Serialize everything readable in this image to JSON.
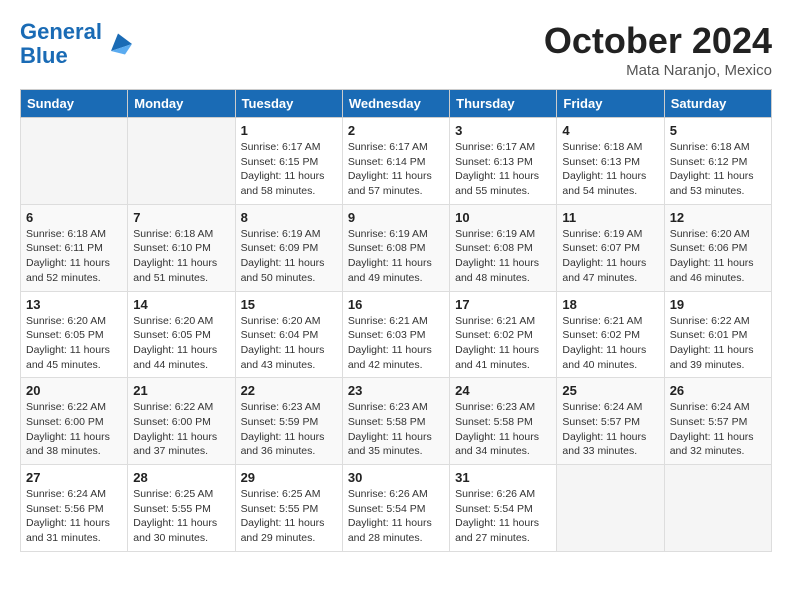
{
  "header": {
    "logo_line1": "General",
    "logo_line2": "Blue",
    "month": "October 2024",
    "location": "Mata Naranjo, Mexico"
  },
  "days_of_week": [
    "Sunday",
    "Monday",
    "Tuesday",
    "Wednesday",
    "Thursday",
    "Friday",
    "Saturday"
  ],
  "weeks": [
    [
      {
        "day": "",
        "sunrise": "",
        "sunset": "",
        "daylight": ""
      },
      {
        "day": "",
        "sunrise": "",
        "sunset": "",
        "daylight": ""
      },
      {
        "day": "1",
        "sunrise": "Sunrise: 6:17 AM",
        "sunset": "Sunset: 6:15 PM",
        "daylight": "Daylight: 11 hours and 58 minutes."
      },
      {
        "day": "2",
        "sunrise": "Sunrise: 6:17 AM",
        "sunset": "Sunset: 6:14 PM",
        "daylight": "Daylight: 11 hours and 57 minutes."
      },
      {
        "day": "3",
        "sunrise": "Sunrise: 6:17 AM",
        "sunset": "Sunset: 6:13 PM",
        "daylight": "Daylight: 11 hours and 55 minutes."
      },
      {
        "day": "4",
        "sunrise": "Sunrise: 6:18 AM",
        "sunset": "Sunset: 6:13 PM",
        "daylight": "Daylight: 11 hours and 54 minutes."
      },
      {
        "day": "5",
        "sunrise": "Sunrise: 6:18 AM",
        "sunset": "Sunset: 6:12 PM",
        "daylight": "Daylight: 11 hours and 53 minutes."
      }
    ],
    [
      {
        "day": "6",
        "sunrise": "Sunrise: 6:18 AM",
        "sunset": "Sunset: 6:11 PM",
        "daylight": "Daylight: 11 hours and 52 minutes."
      },
      {
        "day": "7",
        "sunrise": "Sunrise: 6:18 AM",
        "sunset": "Sunset: 6:10 PM",
        "daylight": "Daylight: 11 hours and 51 minutes."
      },
      {
        "day": "8",
        "sunrise": "Sunrise: 6:19 AM",
        "sunset": "Sunset: 6:09 PM",
        "daylight": "Daylight: 11 hours and 50 minutes."
      },
      {
        "day": "9",
        "sunrise": "Sunrise: 6:19 AM",
        "sunset": "Sunset: 6:08 PM",
        "daylight": "Daylight: 11 hours and 49 minutes."
      },
      {
        "day": "10",
        "sunrise": "Sunrise: 6:19 AM",
        "sunset": "Sunset: 6:08 PM",
        "daylight": "Daylight: 11 hours and 48 minutes."
      },
      {
        "day": "11",
        "sunrise": "Sunrise: 6:19 AM",
        "sunset": "Sunset: 6:07 PM",
        "daylight": "Daylight: 11 hours and 47 minutes."
      },
      {
        "day": "12",
        "sunrise": "Sunrise: 6:20 AM",
        "sunset": "Sunset: 6:06 PM",
        "daylight": "Daylight: 11 hours and 46 minutes."
      }
    ],
    [
      {
        "day": "13",
        "sunrise": "Sunrise: 6:20 AM",
        "sunset": "Sunset: 6:05 PM",
        "daylight": "Daylight: 11 hours and 45 minutes."
      },
      {
        "day": "14",
        "sunrise": "Sunrise: 6:20 AM",
        "sunset": "Sunset: 6:05 PM",
        "daylight": "Daylight: 11 hours and 44 minutes."
      },
      {
        "day": "15",
        "sunrise": "Sunrise: 6:20 AM",
        "sunset": "Sunset: 6:04 PM",
        "daylight": "Daylight: 11 hours and 43 minutes."
      },
      {
        "day": "16",
        "sunrise": "Sunrise: 6:21 AM",
        "sunset": "Sunset: 6:03 PM",
        "daylight": "Daylight: 11 hours and 42 minutes."
      },
      {
        "day": "17",
        "sunrise": "Sunrise: 6:21 AM",
        "sunset": "Sunset: 6:02 PM",
        "daylight": "Daylight: 11 hours and 41 minutes."
      },
      {
        "day": "18",
        "sunrise": "Sunrise: 6:21 AM",
        "sunset": "Sunset: 6:02 PM",
        "daylight": "Daylight: 11 hours and 40 minutes."
      },
      {
        "day": "19",
        "sunrise": "Sunrise: 6:22 AM",
        "sunset": "Sunset: 6:01 PM",
        "daylight": "Daylight: 11 hours and 39 minutes."
      }
    ],
    [
      {
        "day": "20",
        "sunrise": "Sunrise: 6:22 AM",
        "sunset": "Sunset: 6:00 PM",
        "daylight": "Daylight: 11 hours and 38 minutes."
      },
      {
        "day": "21",
        "sunrise": "Sunrise: 6:22 AM",
        "sunset": "Sunset: 6:00 PM",
        "daylight": "Daylight: 11 hours and 37 minutes."
      },
      {
        "day": "22",
        "sunrise": "Sunrise: 6:23 AM",
        "sunset": "Sunset: 5:59 PM",
        "daylight": "Daylight: 11 hours and 36 minutes."
      },
      {
        "day": "23",
        "sunrise": "Sunrise: 6:23 AM",
        "sunset": "Sunset: 5:58 PM",
        "daylight": "Daylight: 11 hours and 35 minutes."
      },
      {
        "day": "24",
        "sunrise": "Sunrise: 6:23 AM",
        "sunset": "Sunset: 5:58 PM",
        "daylight": "Daylight: 11 hours and 34 minutes."
      },
      {
        "day": "25",
        "sunrise": "Sunrise: 6:24 AM",
        "sunset": "Sunset: 5:57 PM",
        "daylight": "Daylight: 11 hours and 33 minutes."
      },
      {
        "day": "26",
        "sunrise": "Sunrise: 6:24 AM",
        "sunset": "Sunset: 5:57 PM",
        "daylight": "Daylight: 11 hours and 32 minutes."
      }
    ],
    [
      {
        "day": "27",
        "sunrise": "Sunrise: 6:24 AM",
        "sunset": "Sunset: 5:56 PM",
        "daylight": "Daylight: 11 hours and 31 minutes."
      },
      {
        "day": "28",
        "sunrise": "Sunrise: 6:25 AM",
        "sunset": "Sunset: 5:55 PM",
        "daylight": "Daylight: 11 hours and 30 minutes."
      },
      {
        "day": "29",
        "sunrise": "Sunrise: 6:25 AM",
        "sunset": "Sunset: 5:55 PM",
        "daylight": "Daylight: 11 hours and 29 minutes."
      },
      {
        "day": "30",
        "sunrise": "Sunrise: 6:26 AM",
        "sunset": "Sunset: 5:54 PM",
        "daylight": "Daylight: 11 hours and 28 minutes."
      },
      {
        "day": "31",
        "sunrise": "Sunrise: 6:26 AM",
        "sunset": "Sunset: 5:54 PM",
        "daylight": "Daylight: 11 hours and 27 minutes."
      },
      {
        "day": "",
        "sunrise": "",
        "sunset": "",
        "daylight": ""
      },
      {
        "day": "",
        "sunrise": "",
        "sunset": "",
        "daylight": ""
      }
    ]
  ]
}
